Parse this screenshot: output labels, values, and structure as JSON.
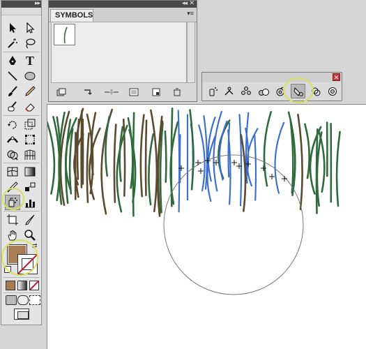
{
  "panels": {
    "symbols": {
      "tab_label": "SYMBOLS",
      "collapse_glyph": "◂◂",
      "close_glyph": "✕",
      "menu_glyph": "▾≡"
    },
    "tools": {
      "collapse_glyph": "▸▸",
      "text_tool_glyph": "T"
    },
    "symbolism_tools": {
      "close_glyph": "✕"
    }
  },
  "colors": {
    "fill": "#a87c54",
    "highlight": "#d9e05a",
    "grass_green": "#2f6b3a",
    "grass_brown": "#5b4a2e",
    "grass_blue": "#3a6fd0"
  },
  "icons": {
    "tools": [
      "selection-icon",
      "direct-selection-icon",
      "magic-wand-icon",
      "lasso-icon",
      "pen-icon",
      "type-icon",
      "line-icon",
      "ellipse-icon",
      "paintbrush-icon",
      "pencil-icon",
      "blob-brush-icon",
      "eraser-icon",
      "rotate-icon",
      "scale-icon",
      "width-icon",
      "free-transform-icon",
      "shape-builder-icon",
      "perspective-grid-icon",
      "mesh-icon",
      "gradient-icon",
      "eyedropper-icon",
      "blend-icon",
      "symbol-sprayer-icon",
      "column-graph-icon",
      "artboard-icon",
      "slice-icon",
      "hand-icon",
      "zoom-icon"
    ],
    "symbolism_tools": [
      "symbol-sprayer-icon",
      "symbol-shifter-icon",
      "symbol-scruncher-icon",
      "symbol-sizer-icon",
      "symbol-spinner-icon",
      "symbol-stainer-icon",
      "symbol-screener-icon",
      "symbol-styler-icon"
    ],
    "symbols_footer": [
      "symbol-libraries-icon",
      "place-symbol-icon",
      "break-link-icon",
      "symbol-options-icon",
      "new-symbol-icon",
      "delete-symbol-icon"
    ]
  }
}
